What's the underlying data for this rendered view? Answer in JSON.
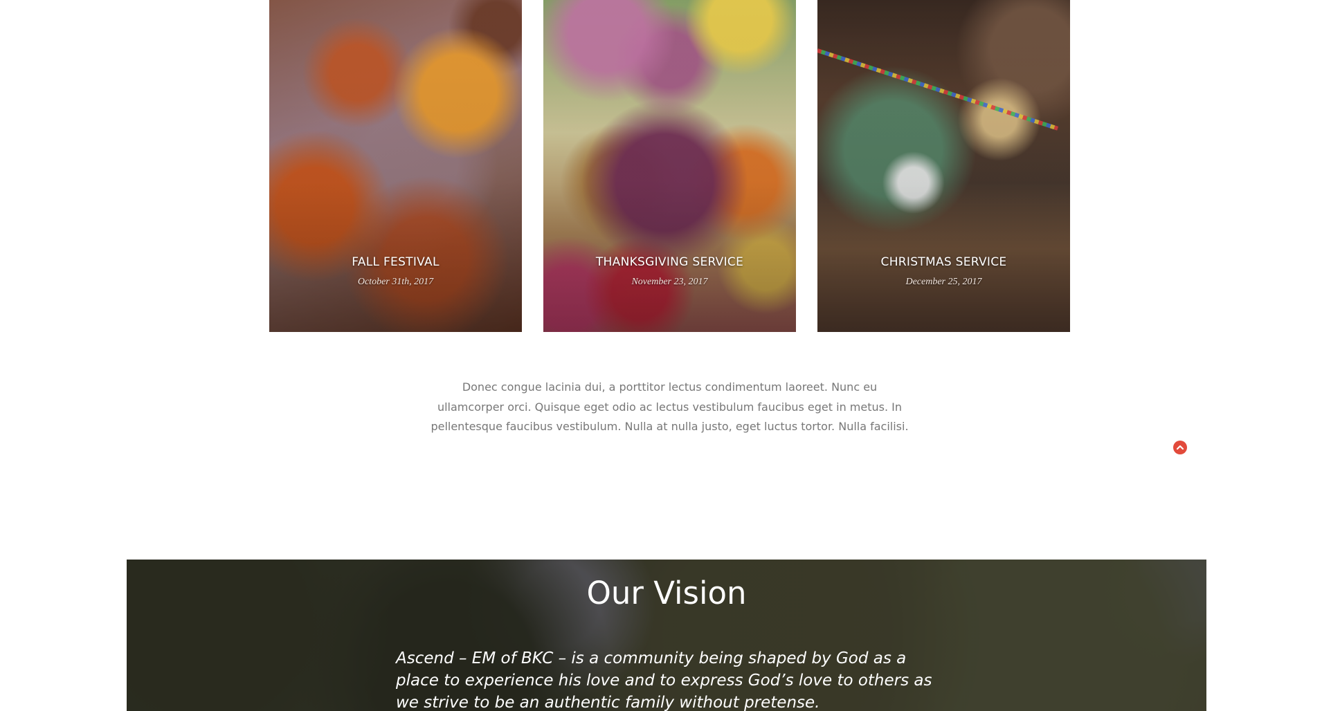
{
  "events": [
    {
      "title": "FALL FESTIVAL",
      "date": "October 31th, 2017"
    },
    {
      "title": "THANKSGIVING SERVICE",
      "date": "November 23, 2017"
    },
    {
      "title": "CHRISTMAS SERVICE",
      "date": "December 25, 2017"
    }
  ],
  "intro": {
    "text": "Donec congue lacinia dui, a porttitor lectus condimentum laoreet. Nunc eu ullamcorper orci. Quisque eget odio ac lectus vestibulum faucibus eget in metus. In pellentesque faucibus vestibulum. Nulla at nulla justo, eget luctus tortor. Nulla facilisi."
  },
  "back_to_top": {
    "icon": "chevron-up-icon",
    "color": "#e24a3b"
  },
  "vision": {
    "heading": "Our Vision",
    "statement": "Ascend – EM of BKC – is a community being shaped by God as a place to experience his love and to express God’s love to others as we strive to be an authentic family without pretense."
  }
}
